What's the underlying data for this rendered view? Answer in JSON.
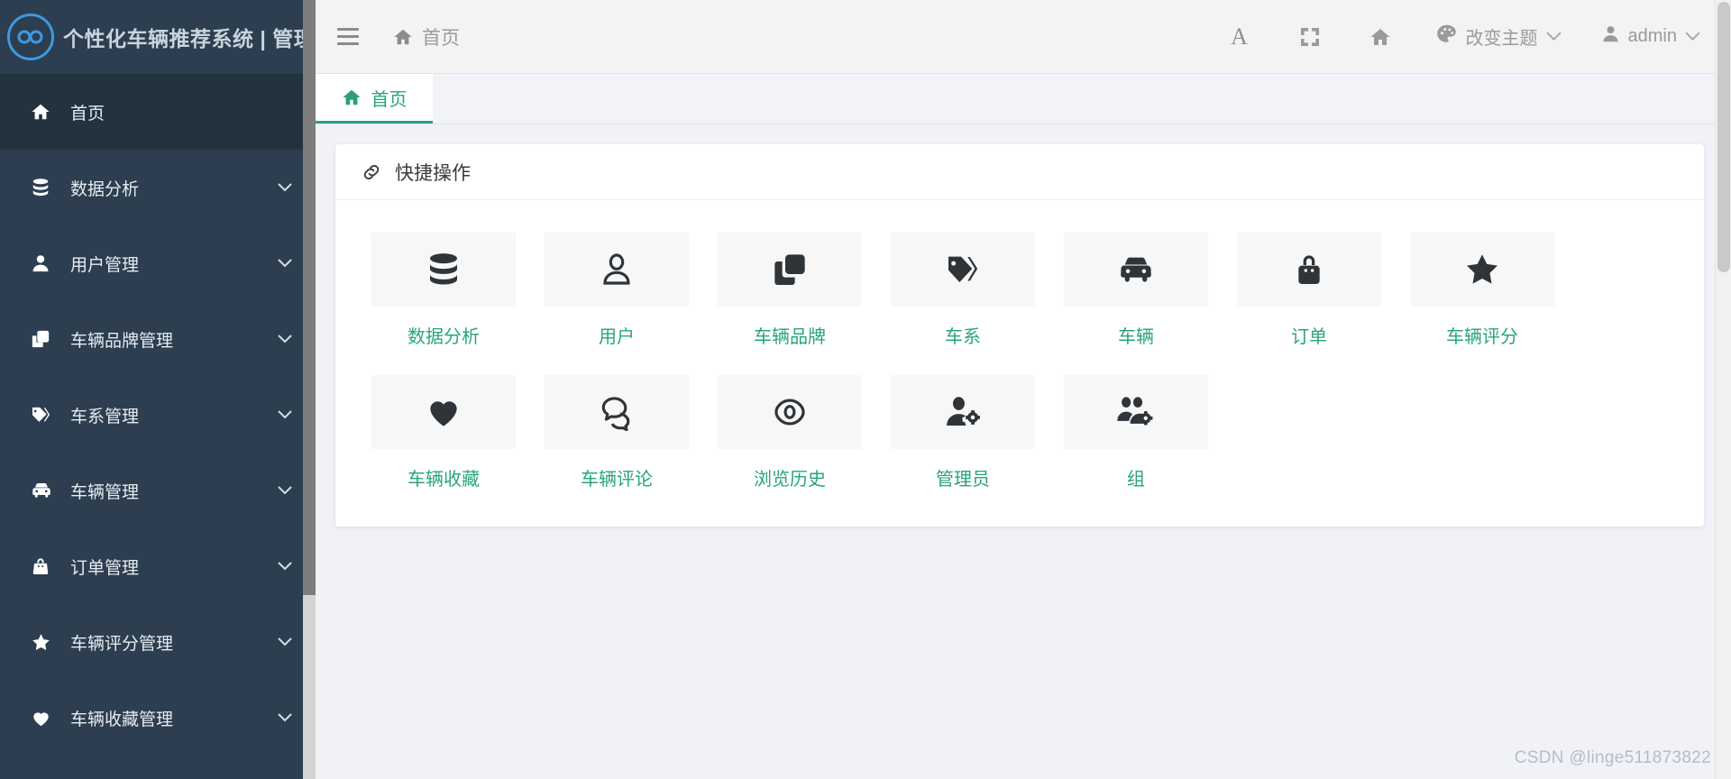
{
  "brand": {
    "title": "个性化车辆推荐系统 | 管理员",
    "logo_icon": "infinity-icon",
    "logo_color": "#3d9ae0"
  },
  "sidebar": {
    "bg_color": "#2c3e50",
    "items": [
      {
        "label": "首页",
        "icon": "home-icon",
        "has_caret": false,
        "active": true
      },
      {
        "label": "数据分析",
        "icon": "database-icon",
        "has_caret": true,
        "active": false
      },
      {
        "label": "用户管理",
        "icon": "user-icon",
        "has_caret": true,
        "active": false
      },
      {
        "label": "车辆品牌管理",
        "icon": "clone-icon",
        "has_caret": true,
        "active": false
      },
      {
        "label": "车系管理",
        "icon": "tags-icon",
        "has_caret": true,
        "active": false
      },
      {
        "label": "车辆管理",
        "icon": "car-icon",
        "has_caret": true,
        "active": false
      },
      {
        "label": "订单管理",
        "icon": "bag-icon",
        "has_caret": true,
        "active": false
      },
      {
        "label": "车辆评分管理",
        "icon": "star-icon",
        "has_caret": true,
        "active": false
      },
      {
        "label": "车辆收藏管理",
        "icon": "heart-icon",
        "has_caret": true,
        "active": false
      }
    ]
  },
  "topbar": {
    "menu_toggle_icon": "hamburger-icon",
    "breadcrumb_icon": "home-icon",
    "breadcrumb": "首页",
    "actions": [
      {
        "icon": "font-size-icon",
        "label": "A"
      },
      {
        "icon": "fullscreen-icon",
        "label": ""
      },
      {
        "icon": "home-icon",
        "label": ""
      }
    ],
    "theme": {
      "icon": "palette-icon",
      "label": "改变主题",
      "caret": "chevron-down-icon"
    },
    "user": {
      "icon": "user-icon",
      "label": "admin",
      "caret": "chevron-down-icon"
    }
  },
  "tabs": [
    {
      "label": "首页",
      "icon": "home-icon",
      "active": true
    }
  ],
  "card": {
    "title": "快捷操作",
    "title_icon": "link-icon",
    "accent_color": "#28a47e",
    "tile_rows": [
      [
        {
          "label": "数据分析",
          "icon": "database-icon"
        },
        {
          "label": "用户",
          "icon": "user-icon"
        },
        {
          "label": "车辆品牌",
          "icon": "clone-icon"
        },
        {
          "label": "车系",
          "icon": "tags-icon"
        },
        {
          "label": "车辆",
          "icon": "car-icon"
        },
        {
          "label": "订单",
          "icon": "bag-icon"
        },
        {
          "label": "车辆评分",
          "icon": "star-icon"
        }
      ],
      [
        {
          "label": "车辆收藏",
          "icon": "heart-icon"
        },
        {
          "label": "车辆评论",
          "icon": "comments-icon"
        },
        {
          "label": "浏览历史",
          "icon": "eye-icon"
        },
        {
          "label": "管理员",
          "icon": "user-gear-icon"
        },
        {
          "label": "组",
          "icon": "users-gear-icon"
        }
      ]
    ]
  },
  "watermark": "CSDN @linge511873822"
}
